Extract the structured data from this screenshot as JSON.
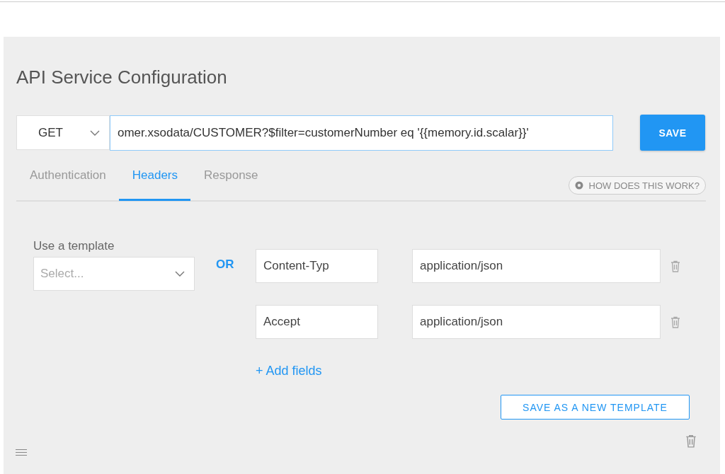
{
  "title": "API Service Configuration",
  "request": {
    "method": "GET",
    "url": "omer.xsodata/CUSTOMER?$filter=customerNumber eq '{{memory.id.scalar}}'",
    "save_label": "SAVE"
  },
  "tabs": [
    {
      "label": "Authentication",
      "selected": false
    },
    {
      "label": "Headers",
      "selected": true
    },
    {
      "label": "Response",
      "selected": false
    }
  ],
  "help_label": "HOW DOES THIS WORK?",
  "template": {
    "label": "Use a template",
    "placeholder": "Select..."
  },
  "or_label": "OR",
  "headers": [
    {
      "key": "Content-Typ",
      "value": "application/json"
    },
    {
      "key": "Accept",
      "value": "application/json"
    }
  ],
  "add_fields_label": "+ Add fields",
  "save_template_label": "SAVE AS A NEW TEMPLATE"
}
